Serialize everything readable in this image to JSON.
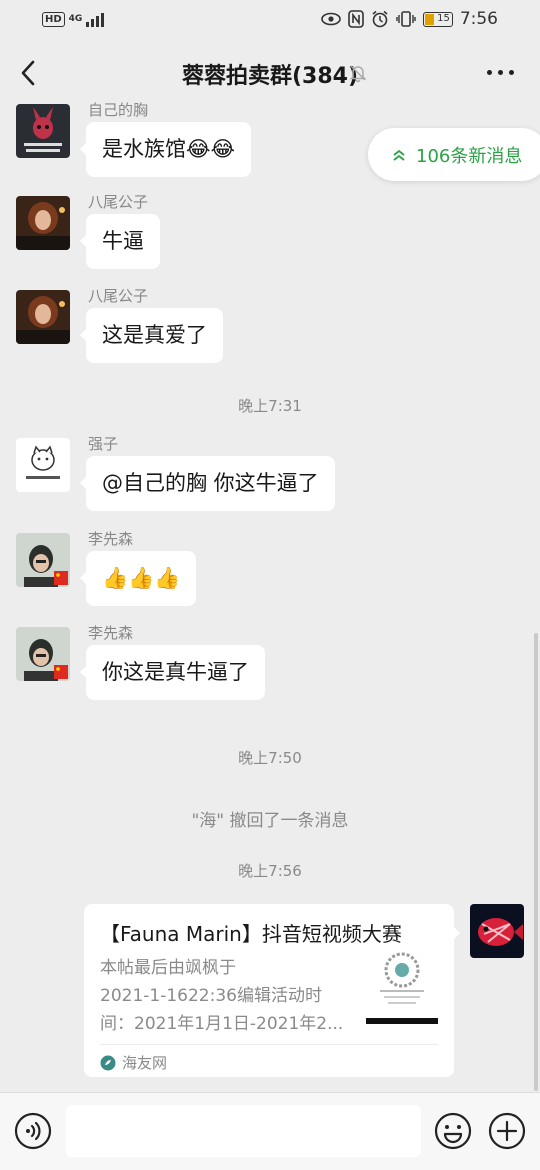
{
  "status_bar": {
    "network": "HD",
    "signal_type": "4G",
    "battery": "15",
    "time": "7:56"
  },
  "nav": {
    "title": "蓉蓉拍卖群(384)",
    "back_icon": "chevron-left-icon",
    "mute_icon": "bell-muted-icon",
    "more_icon": "more-dots-icon"
  },
  "new_messages": {
    "label": "106条新消息",
    "color": "#2ba245"
  },
  "messages": [
    {
      "sender": "自己的胸",
      "text": "是水族馆😂😂"
    },
    {
      "sender": "八尾公子",
      "text": "牛逼"
    },
    {
      "sender": "八尾公子",
      "text": "这是真爱了"
    },
    {
      "time": "晚上7:31"
    },
    {
      "sender": "强子",
      "text": "@自己的胸  你这牛逼了"
    },
    {
      "sender": "李先森",
      "text": "👍👍👍"
    },
    {
      "sender": "李先森",
      "text": "你这是真牛逼了"
    },
    {
      "time": "晚上7:50"
    },
    {
      "system": "\"海\" 撤回了一条消息"
    },
    {
      "time": "晚上7:56"
    }
  ],
  "link_card": {
    "title": "【Fauna Marin】抖音短视频大赛",
    "desc_lines": [
      "本帖最后由飒枫于",
      "2021-1-1622:36编辑活动时",
      "间：2021年1月1日-2021年2..."
    ],
    "source": "海友网",
    "accent": "#2ba245"
  },
  "input": {
    "placeholder": ""
  }
}
